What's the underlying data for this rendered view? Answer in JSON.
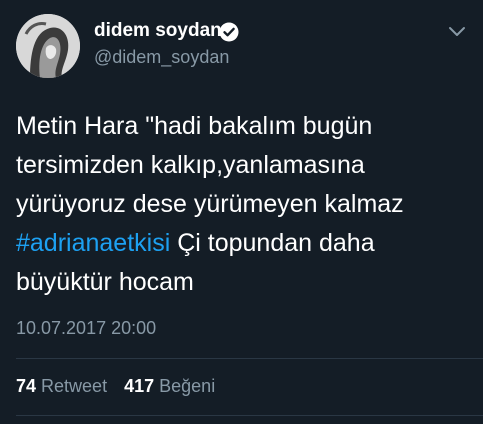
{
  "author": {
    "display_name": "didem soydan",
    "handle": "@didem_soydan",
    "verified": true
  },
  "tweet": {
    "lines": [
      "Metin Hara \"hadi bakalım bugün",
      "tersimizden kalkıp,yanlamasına",
      "yürüyoruz dese yürümeyen kalmaz"
    ],
    "hashtag": "#adrianaetkisi",
    "after_hashtag": " Çi topundan daha",
    "last_line": "büyüktür hocam"
  },
  "timestamp": "10.07.2017 20:00",
  "stats": {
    "retweet_count": "74",
    "retweet_label": "Retweet",
    "like_count": "417",
    "like_label": "Beğeni"
  },
  "colors": {
    "background": "#141d26",
    "text": "#ffffff",
    "secondary_text": "#8899a6",
    "accent": "#1da1f2",
    "divider": "#2a3744"
  },
  "icons": {
    "verified": "verified-badge-icon",
    "menu": "chevron-down-icon"
  }
}
